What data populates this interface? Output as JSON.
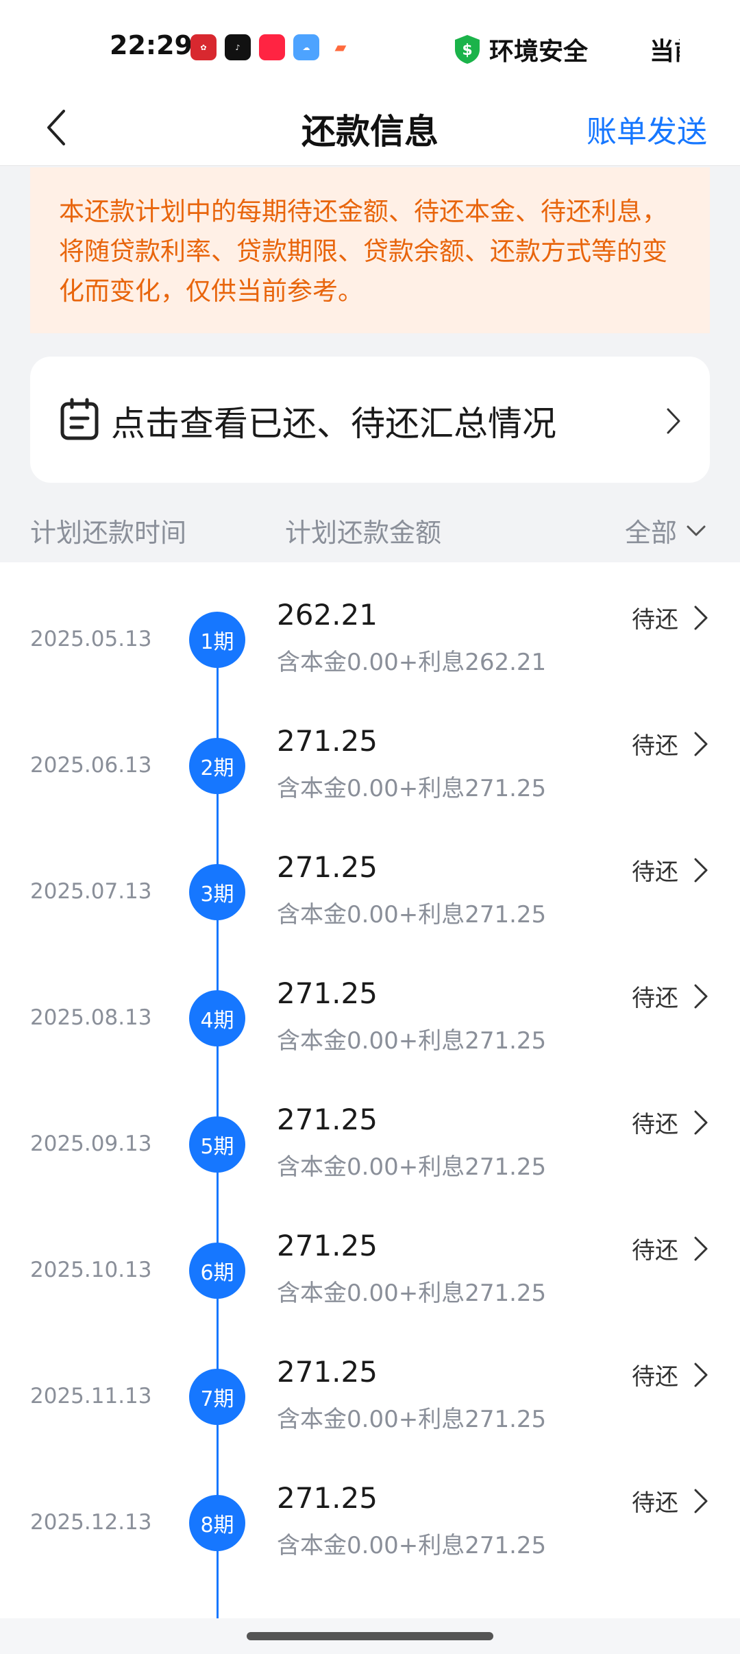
{
  "status_bar": {
    "time": "22:29",
    "apps": [
      "toutiao-app-icon",
      "tiktok-app-icon",
      "xiaohongshu-app-icon",
      "weather-app-icon",
      "game-app-icon"
    ],
    "security_text": "环境安全",
    "right_text": "当前"
  },
  "nav": {
    "title": "还款信息",
    "send_bill_label": "账单发送"
  },
  "notice": {
    "text": "本还款计划中的每期待还金额、待还本金、待还利息，将随贷款利率、贷款期限、贷款余额、还款方式等的变化而变化，仅供当前参考。"
  },
  "summary": {
    "label": "点击查看已还、待还汇总情况"
  },
  "list_header": {
    "time_label": "计划还款时间",
    "amount_label": "计划还款金额",
    "filter_label": "全部"
  },
  "rows": [
    {
      "date": "2025.05.13",
      "period": "1期",
      "amount": "262.21",
      "detail": "含本金0.00+利息262.21",
      "status": "待还"
    },
    {
      "date": "2025.06.13",
      "period": "2期",
      "amount": "271.25",
      "detail": "含本金0.00+利息271.25",
      "status": "待还"
    },
    {
      "date": "2025.07.13",
      "period": "3期",
      "amount": "271.25",
      "detail": "含本金0.00+利息271.25",
      "status": "待还"
    },
    {
      "date": "2025.08.13",
      "period": "4期",
      "amount": "271.25",
      "detail": "含本金0.00+利息271.25",
      "status": "待还"
    },
    {
      "date": "2025.09.13",
      "period": "5期",
      "amount": "271.25",
      "detail": "含本金0.00+利息271.25",
      "status": "待还"
    },
    {
      "date": "2025.10.13",
      "period": "6期",
      "amount": "271.25",
      "detail": "含本金0.00+利息271.25",
      "status": "待还"
    },
    {
      "date": "2025.11.13",
      "period": "7期",
      "amount": "271.25",
      "detail": "含本金0.00+利息271.25",
      "status": "待还"
    },
    {
      "date": "2025.12.13",
      "period": "8期",
      "amount": "271.25",
      "detail": "含本金0.00+利息271.25",
      "status": "待还"
    }
  ],
  "colors": {
    "accent": "#1677ff",
    "notice_text": "#e8650c",
    "notice_bg": "#fff0e6"
  }
}
